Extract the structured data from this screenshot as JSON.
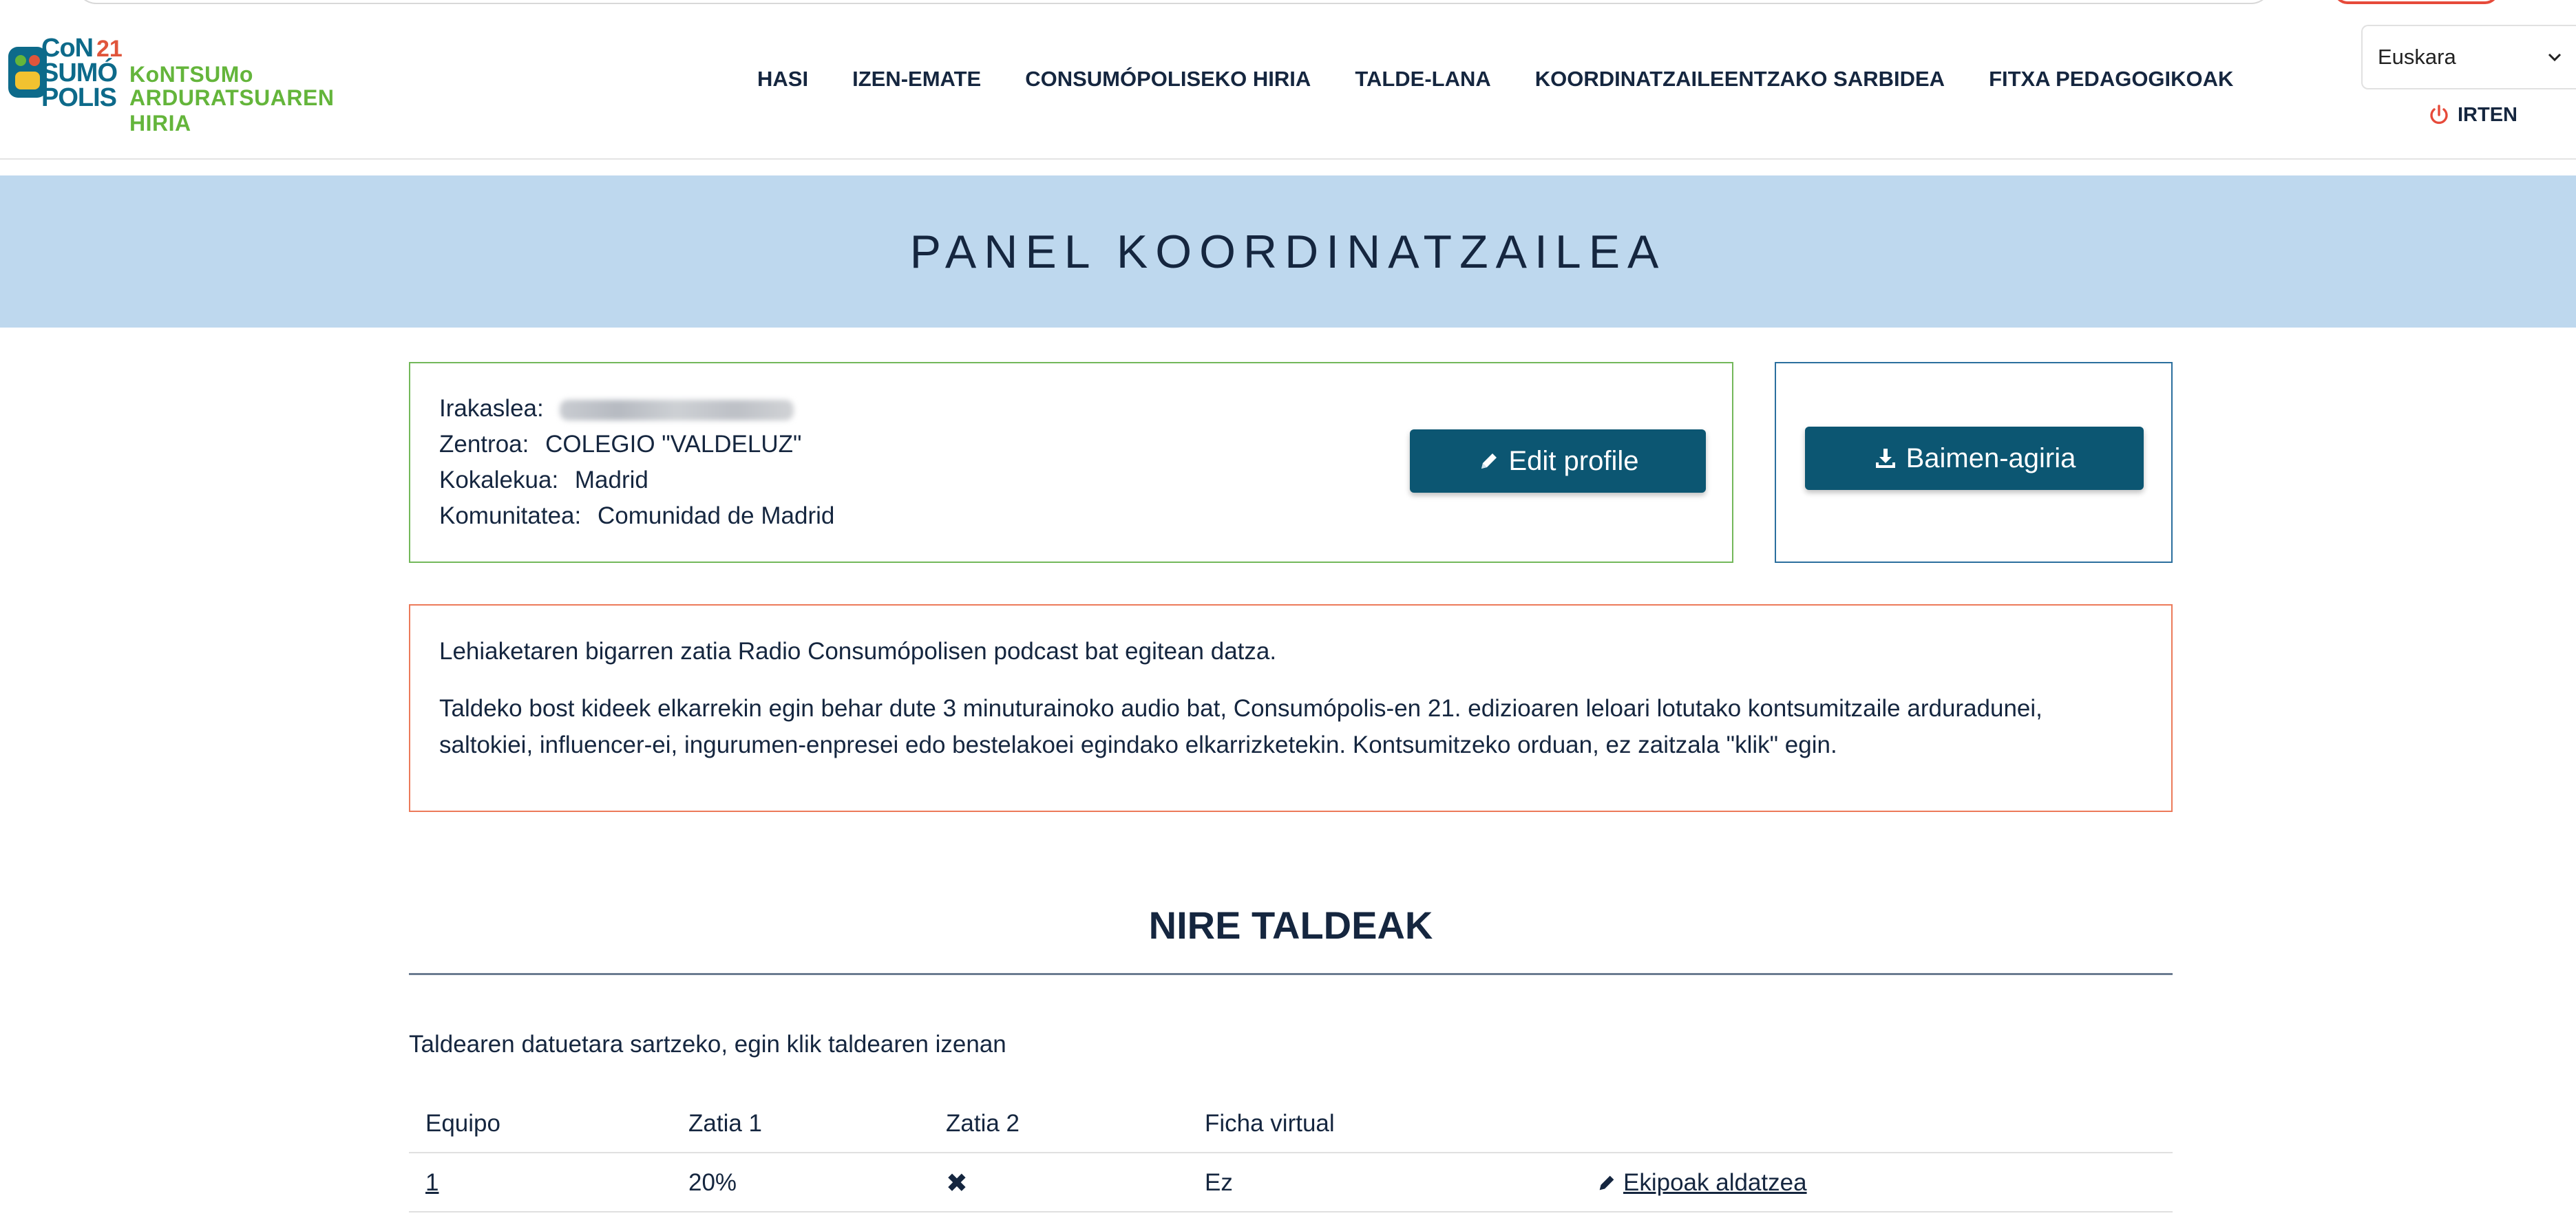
{
  "header": {
    "logo": {
      "word_line1": "CoN",
      "word_line2": "SUMÓ",
      "word_line3": "POLIS",
      "number": "21",
      "tagline1": "KoNTSUMo",
      "tagline2": "ARDURATSUAREN HIRIA"
    },
    "nav": [
      {
        "label": "HASI"
      },
      {
        "label": "IZEN-EMATE"
      },
      {
        "label": "CONSUMÓPOLISEKO HIRIA"
      },
      {
        "label": "TALDE-LANA"
      },
      {
        "label": "KOORDINATZAILEENTZAKO SARBIDEA"
      },
      {
        "label": "FITXA PEDAGOGIKOAK"
      }
    ],
    "language": {
      "selected": "Euskara"
    },
    "logout_label": "IRTEN"
  },
  "banner": {
    "title": "PANEL KOORDINATZAILEA"
  },
  "profile": {
    "teacher_label": "Irakaslea:",
    "center_label": "Zentroa:",
    "center_value": "COLEGIO \"VALDELUZ\"",
    "location_label": "Kokalekua:",
    "location_value": "Madrid",
    "community_label": "Komunitatea:",
    "community_value": "Comunidad de Madrid",
    "edit_button": "Edit profile"
  },
  "documents": {
    "button": "Baimen-agiria"
  },
  "notice": {
    "paragraph1": "Lehiaketaren bigarren zatia Radio Consumópolisen podcast bat egitean datza.",
    "paragraph2": "Taldeko bost kideek elkarrekin egin behar dute 3 minuturainoko audio bat, Consumópolis-en 21. edizioaren leloari lotutako kontsumitzaile arduradunei, saltokiei, influencer-ei, ingurumen-enpresei edo bestelakoei egindako elkarrizketekin. Kontsumitzeko orduan, ez zaitzala \"klik\" egin."
  },
  "teams": {
    "title": "NIRE TALDEAK",
    "hint": "Taldearen datuetara sartzeko, egin klik taldearen izenan",
    "columns": [
      "Equipo",
      "Zatia 1",
      "Zatia 2",
      "Ficha virtual"
    ],
    "rows": [
      {
        "team": "1",
        "part1": "20%",
        "part2": "✖",
        "virtual": "Ez",
        "action": "Ekipoak aldatzea"
      }
    ]
  },
  "colors": {
    "primary_button": "#0c5672",
    "banner_bg": "#bed8ee",
    "profile_border": "#73b85a",
    "notice_border": "#ec7a5a",
    "logout_icon": "#e64a3a"
  }
}
